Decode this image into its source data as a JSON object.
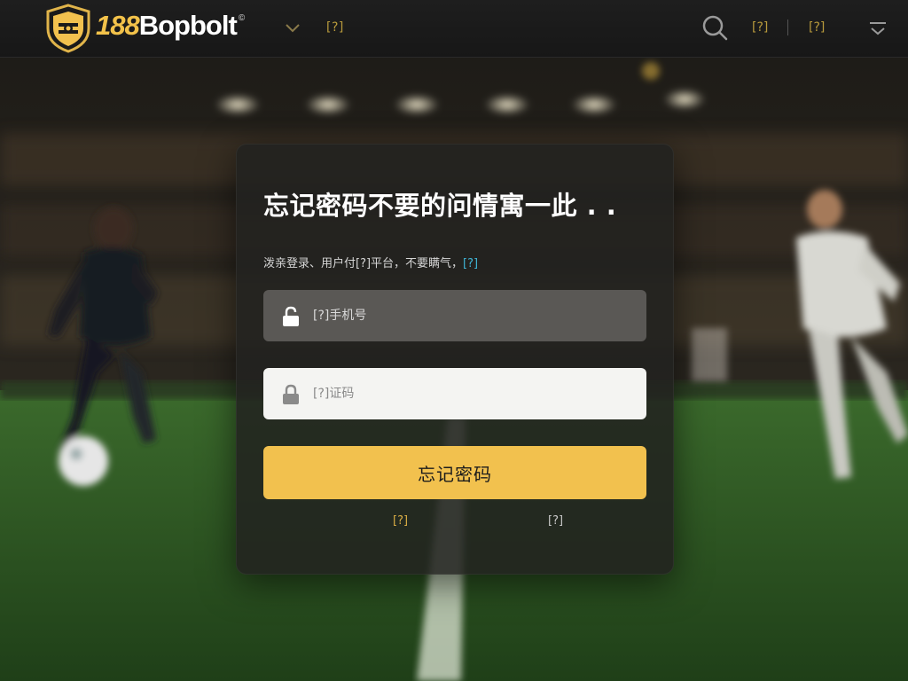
{
  "colors": {
    "brand_gold": "#f2c14e",
    "link_blue": "#3fb6d8",
    "topbar_bg": "#1b1b1b",
    "card_bg": "#222220"
  },
  "header": {
    "logo_number": "188",
    "logo_name": "Bopbolt",
    "logo_mark": "©",
    "nav_link": "[?]",
    "top_link_a": "[?]",
    "top_link_b": "[?]",
    "icons": [
      "shield-logo",
      "chevron-down-icon",
      "search-icon",
      "menu-icon"
    ]
  },
  "card": {
    "title": "忘记密码不要的问情寓一此 . .",
    "description": "泼亲登录、用户付[?]平台，不要瞒气，",
    "description_link": "[?]",
    "account_field": {
      "placeholder": "[?]手机号",
      "value": "",
      "icon": "lock-open-icon"
    },
    "code_field": {
      "placeholder": "[?]证码",
      "value": "",
      "icon": "lock-icon"
    },
    "submit_label": "忘记密码",
    "footer_left": "[?]",
    "footer_right": "[?]"
  }
}
